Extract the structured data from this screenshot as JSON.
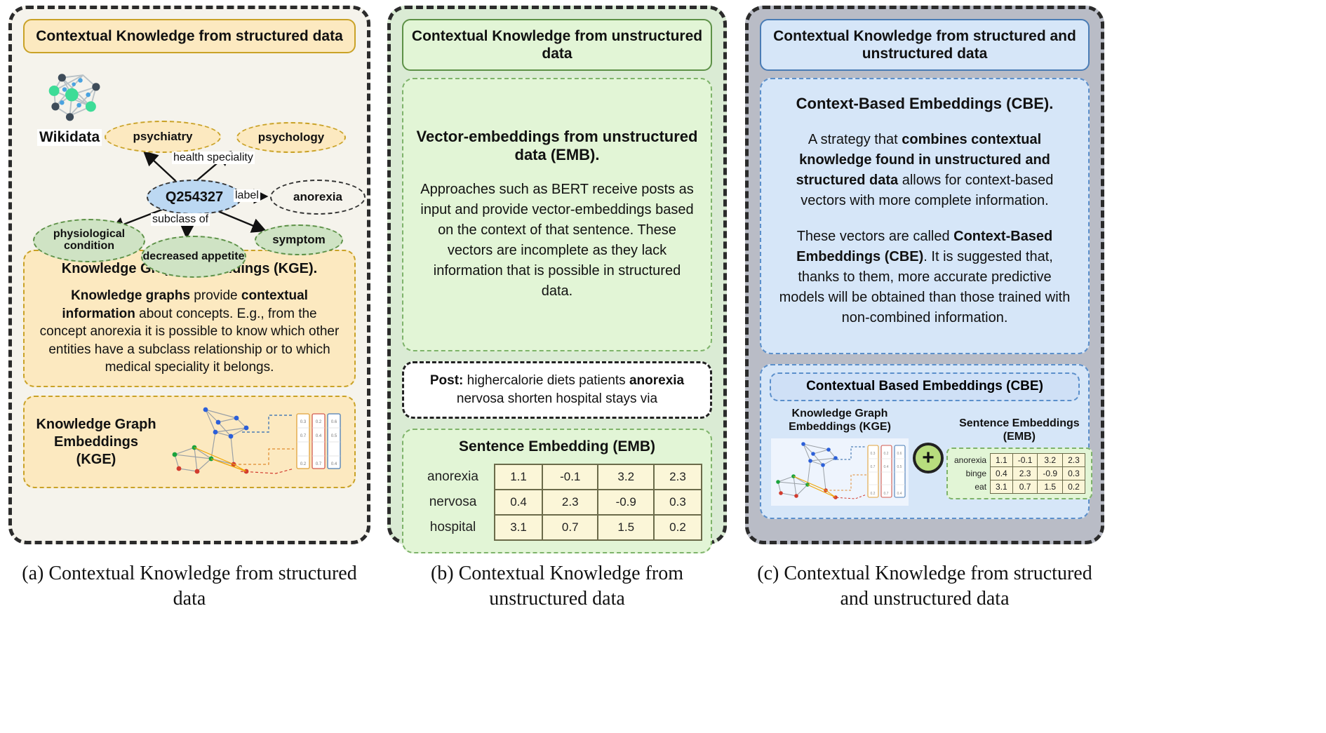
{
  "panels": {
    "a": {
      "header": "Contextual Knowledge from structured data",
      "source_label": "Wikidata",
      "graph": {
        "center": "Q254327",
        "nodes": {
          "psychiatry": "psychiatry",
          "psychology": "psychology",
          "anorexia": "anorexia",
          "physiological_condition": "physiological condition",
          "decreased_appetite": "decreased appetite",
          "symptom": "symptom"
        },
        "edges": {
          "health_speciality": "health speciality",
          "label": "label",
          "subclass_of": "subclass of"
        }
      },
      "kge_card": {
        "title": "Knowledge Graph Embeddings (KGE).",
        "body_part1_bold": "Knowledge graphs",
        "body_part2": " provide ",
        "body_part3_bold": "contextual information",
        "body_part4": " about concepts. E.g., from the concept anorexia it is possible to know which other entities have a subclass relationship or to which medical speciality it belongs."
      },
      "kge_illus_label": "Knowledge Graph Embeddings (KGE)"
    },
    "b": {
      "header": "Contextual Knowledge from unstructured data",
      "emb_card": {
        "title": "Vector-embeddings from unstructured data (EMB).",
        "body": "Approaches such as BERT receive posts as input and provide vector-embeddings based on the context of that sentence. These vectors are incomplete as they lack information that is possible in structured data."
      },
      "post": {
        "label": "Post:",
        "text_before_bold": " highercalorie diets patients ",
        "bold_word": "anorexia",
        "text_after_bold": " nervosa shorten hospital stays via"
      },
      "sentence_embedding": {
        "title": "Sentence Embedding (EMB)",
        "rows": [
          {
            "label": "anorexia",
            "values": [
              "1.1",
              "-0.1",
              "3.2",
              "2.3"
            ]
          },
          {
            "label": "nervosa",
            "values": [
              "0.4",
              "2.3",
              "-0.9",
              "0.3"
            ]
          },
          {
            "label": "hospital",
            "values": [
              "3.1",
              "0.7",
              "1.5",
              "0.2"
            ]
          }
        ]
      }
    },
    "c": {
      "header": "Contextual Knowledge from structured and unstructured data",
      "cbe_card": {
        "title": "Context-Based Embeddings (CBE).",
        "p1_a": "A strategy that ",
        "p1_b_bold": "combines contextual knowledge found in unstructured and structured data",
        "p1_c": " allows for context-based vectors with more complete information.",
        "p2_a": "These vectors are called ",
        "p2_b_bold": "Context-Based Embeddings (CBE)",
        "p2_c": ". It is suggested that, thanks to them, more accurate predictive models will be obtained than those trained with non-combined information."
      },
      "cbe_illus": {
        "title": "Contextual Based Embeddings (CBE)",
        "left_label": "Knowledge Graph Embeddings (KGE)",
        "right_label": "Sentence Embeddings (EMB)",
        "operator": "+",
        "mini_table": {
          "rows": [
            {
              "label": "anorexia",
              "values": [
                "1.1",
                "-0.1",
                "3.2",
                "2.3"
              ]
            },
            {
              "label": "binge",
              "values": [
                "0.4",
                "2.3",
                "-0.9",
                "0.3"
              ]
            },
            {
              "label": "eat",
              "values": [
                "3.1",
                "0.7",
                "1.5",
                "0.2"
              ]
            }
          ]
        }
      }
    }
  },
  "captions": {
    "a": "(a) Contextual Knowledge from structured data",
    "b": "(b) Contextual Knowledge from unstructured data",
    "c": "(c) Contextual Knowledge from structured and unstructured data"
  },
  "colors": {
    "yellow_fill": "#fce9c0",
    "yellow_border": "#c9a227",
    "green_fill": "#e2f5d6",
    "green_border": "#5d9147",
    "blue_fill": "#d6e6f8",
    "blue_border": "#4a7cb5",
    "node_blue": "#bcd8f2",
    "node_green": "#cfe3c4",
    "panel_a_bg": "#f5f3ec",
    "panel_b_bg": "#daebd4",
    "panel_c_bg": "#b9bcc6",
    "plus_badge": "#b8dd7e"
  }
}
